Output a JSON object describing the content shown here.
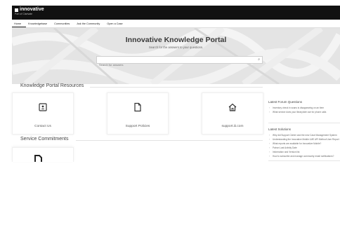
{
  "brand": {
    "name": "innovative",
    "tagline": "Part of Clarivate"
  },
  "nav": [
    {
      "label": "Home"
    },
    {
      "label": "Knowledgebase"
    },
    {
      "label": "Communities"
    },
    {
      "label": "Ask the Community"
    },
    {
      "label": "Open a Case"
    }
  ],
  "hero": {
    "title": "Innovative Knowledge Portal",
    "subtitle": "Search for the answers to your questions.",
    "search_placeholder": "Search for answers"
  },
  "resources": {
    "title": "Knowledge Portal Resources",
    "cards": [
      {
        "label": "Contact Us",
        "icon": "contact-card-icon"
      },
      {
        "label": "Support Policies",
        "icon": "document-icon"
      },
      {
        "label": "support.iii.com",
        "icon": "home-icon"
      }
    ]
  },
  "commitments": {
    "title": "Service Commitments"
  },
  "forum": {
    "title": "Latest Forum Questions",
    "items": [
      "Inventory check in scans is disappearing on an item",
      "What service does your library/site use for phone calls"
    ]
  },
  "solutions": {
    "title": "Latest Solutions",
    "items": [
      "Why did Support Center and the new Case Management System",
      "Understanding the Innovative Mobile LME API Method User Report",
      "What reports are available for Innovative Mobile?",
      "Patron Last Activity Date",
      "Information and Version list",
      "How to subscribe and manage community email notifications?"
    ]
  },
  "colors": {
    "topbar": "#111111",
    "hero_bg": "#e4e4e4",
    "accent": "#222222"
  }
}
